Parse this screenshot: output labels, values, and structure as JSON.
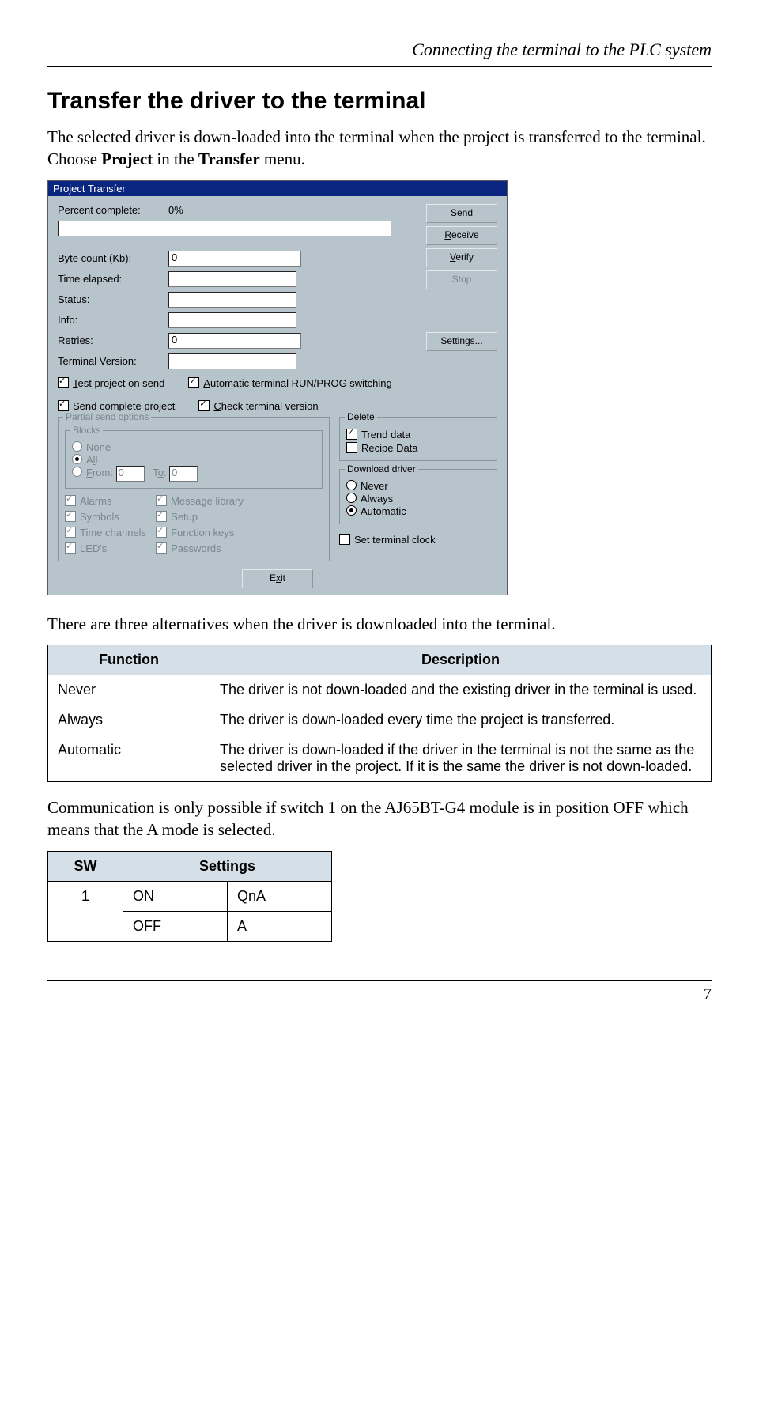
{
  "header": "Connecting the terminal to the PLC system",
  "h1": "Transfer the driver to the terminal",
  "p1a": "The selected driver is down-loaded into the terminal when the project is transferred to the terminal. Choose ",
  "p1b": "Project",
  "p1c": " in the ",
  "p1d": "Transfer",
  "p1e": " menu.",
  "dialog": {
    "title": "Project Transfer",
    "percent_label": "Percent complete:",
    "percent": "0%",
    "byte_label": "Byte count (Kb):",
    "byte": "0",
    "time_label": "Time elapsed:",
    "status_label": "Status:",
    "info_label": "Info:",
    "retries_label": "Retries:",
    "retries": "0",
    "termver_label": "Terminal Version:",
    "btn_send": "Send",
    "btn_receive": "Receive",
    "btn_verify": "Verify",
    "btn_stop": "Stop",
    "btn_settings": "Settings...",
    "chk_test": "Test project on send",
    "chk_auto": "Automatic terminal RUN/PROG switching",
    "chk_sendcomplete": "Send complete project",
    "chk_checkver": "Check terminal version",
    "grp_partial": "Partial send options",
    "grp_blocks": "Blocks",
    "rad_none": "None",
    "rad_all": "All",
    "rad_from": "From:",
    "to": "To:",
    "chk_alarms": "Alarms",
    "chk_symbols": "Symbols",
    "chk_tch": "Time channels",
    "chk_leds": "LED's",
    "chk_msg": "Message library",
    "chk_setup": "Setup",
    "chk_fkeys": "Function keys",
    "chk_pwd": "Passwords",
    "grp_delete": "Delete",
    "chk_trend": "Trend data",
    "chk_recipe": "Recipe Data",
    "grp_dl": "Download driver",
    "rad_never": "Never",
    "rad_always": "Always",
    "rad_auto": "Automatic",
    "chk_clock": "Set terminal clock",
    "btn_exit": "Exit"
  },
  "p2": "There are three alternatives when the driver is downloaded into the terminal.",
  "tbl": {
    "h1": "Function",
    "h2": "Description",
    "r1f": "Never",
    "r1d": "The driver is not down-loaded and the existing driver in the terminal is used.",
    "r2f": "Always",
    "r2d": "The driver is down-loaded every time the project is transferred.",
    "r3f": "Automatic",
    "r3d": "The driver is down-loaded if the driver in the terminal is not the same as the selected driver in the project. If it is the same the driver is not down-loaded."
  },
  "p3": "Communication is only possible if switch 1 on the AJ65BT-G4 module is in position OFF which means that the A mode is selected.",
  "sw": {
    "h1": "SW",
    "h2": "Settings",
    "sw1": "1",
    "on": "ON",
    "off": "OFF",
    "qna": "QnA",
    "a": "A"
  },
  "page": "7"
}
